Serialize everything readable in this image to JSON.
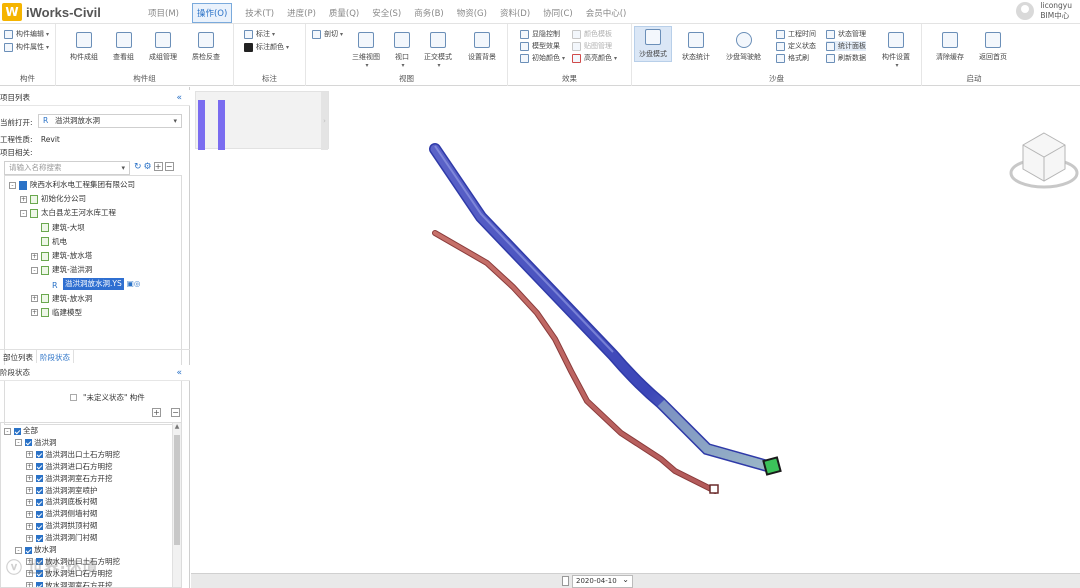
{
  "app": {
    "logo_letter": "W",
    "title": "iWorks-Civil",
    "menu": [
      "项目(M)",
      "操作(O)",
      "技术(T)",
      "进度(P)",
      "质量(Q)",
      "安全(S)",
      "商务(B)",
      "物资(G)",
      "资料(D)",
      "协同(C)",
      "会员中心()"
    ],
    "active_menu": "操作(O)",
    "user_name": "licongyu",
    "user_center": "BIM中心"
  },
  "ribbon": {
    "components": {
      "label": "构件",
      "edit": "构件编辑",
      "props": "构件属性"
    },
    "component_group": {
      "label": "构件组",
      "form": "构件成组",
      "view": "查看组",
      "manage": "成组管理",
      "check": "质检反查"
    },
    "annotation": {
      "label": "标注",
      "mark": "标注",
      "mark_color": "标注颜色"
    },
    "view": {
      "label": "视图",
      "section": "剖切",
      "three_d": "三维视图",
      "viewport": "视口",
      "ortho": "正交模式",
      "background": "设置背景"
    },
    "effects": {
      "label": "效果",
      "show_hide": "显隐控制",
      "model_effect": "模型效果",
      "init_color": "初始颜色",
      "color_mode": "颜色模板",
      "tint_manage": "贴图管理",
      "highlight_color": "高亮颜色"
    },
    "sandbox": {
      "label": "沙盘",
      "mode": "沙盘模式",
      "status_stats": "状态统计",
      "roam": "沙盘驾驶舱",
      "work_time": "工程时间",
      "def_status": "定义状态",
      "format_brush": "格式刷",
      "status_manage": "状态管理",
      "stats_panel": "统计面板",
      "refresh": "刷新数据",
      "settings": "构件设置"
    },
    "start": {
      "label": "启动",
      "clear_cache": "清除缓存",
      "home": "返回首页"
    }
  },
  "left": {
    "project_list_title": "项目列表",
    "current_open_label": "当前打开:",
    "current_open_value": "溢洪洞放水洞",
    "project_type_label": "工程性质:",
    "project_type_value": "Revit",
    "project_related_label": "项目相关:",
    "search_placeholder": "请输入名称搜索",
    "tree": [
      {
        "label": "陕西水利水电工程集团有限公司",
        "level": 0,
        "exp": "-"
      },
      {
        "label": "初始化分公司",
        "level": 1,
        "exp": "+"
      },
      {
        "label": "太白县龙王河水库工程",
        "level": 1,
        "exp": "-"
      },
      {
        "label": "建筑-大坝",
        "level": 2,
        "exp": ""
      },
      {
        "label": "机电",
        "level": 2,
        "exp": ""
      },
      {
        "label": "建筑-放水塔",
        "level": 2,
        "exp": "+"
      },
      {
        "label": "建筑-溢洪洞",
        "level": 2,
        "exp": "-"
      },
      {
        "label": "溢洪洞放水洞.YS",
        "level": 3,
        "exp": "",
        "selected": true
      },
      {
        "label": "建筑-放水洞",
        "level": 2,
        "exp": "+"
      },
      {
        "label": "临建模型",
        "level": 2,
        "exp": "+"
      }
    ],
    "tabs": [
      "部位列表",
      "阶段状态"
    ],
    "active_tab": "阶段状态",
    "stage_title": "阶段状态",
    "undefined_label": "\"未定义状态\" 构件",
    "stage_tree": [
      {
        "label": "全部",
        "level": 0,
        "exp": "-"
      },
      {
        "label": "溢洪洞",
        "level": 1,
        "exp": "-"
      },
      {
        "label": "溢洪洞出口土石方明挖",
        "level": 2,
        "exp": "+"
      },
      {
        "label": "溢洪洞进口石方明挖",
        "level": 2,
        "exp": "+"
      },
      {
        "label": "溢洪洞洞室石方开挖",
        "level": 2,
        "exp": "+"
      },
      {
        "label": "溢洪洞洞室喷护",
        "level": 2,
        "exp": "+"
      },
      {
        "label": "溢洪洞底板衬砌",
        "level": 2,
        "exp": "+"
      },
      {
        "label": "溢洪洞侧墙衬砌",
        "level": 2,
        "exp": "+"
      },
      {
        "label": "溢洪洞拱顶衬砌",
        "level": 2,
        "exp": "+"
      },
      {
        "label": "溢洪洞洞门衬砌",
        "level": 2,
        "exp": "+"
      },
      {
        "label": "放水洞",
        "level": 1,
        "exp": "-"
      },
      {
        "label": "放水洞出口土石方明挖",
        "level": 2,
        "exp": "+"
      },
      {
        "label": "放水洞进口石方明挖",
        "level": 2,
        "exp": "+"
      },
      {
        "label": "放水洞洞室石方开挖",
        "level": 2,
        "exp": "+"
      }
    ]
  },
  "viewport": {
    "date_value": "2020-04-10"
  },
  "watermark": "ⓥ 世界·环境"
}
